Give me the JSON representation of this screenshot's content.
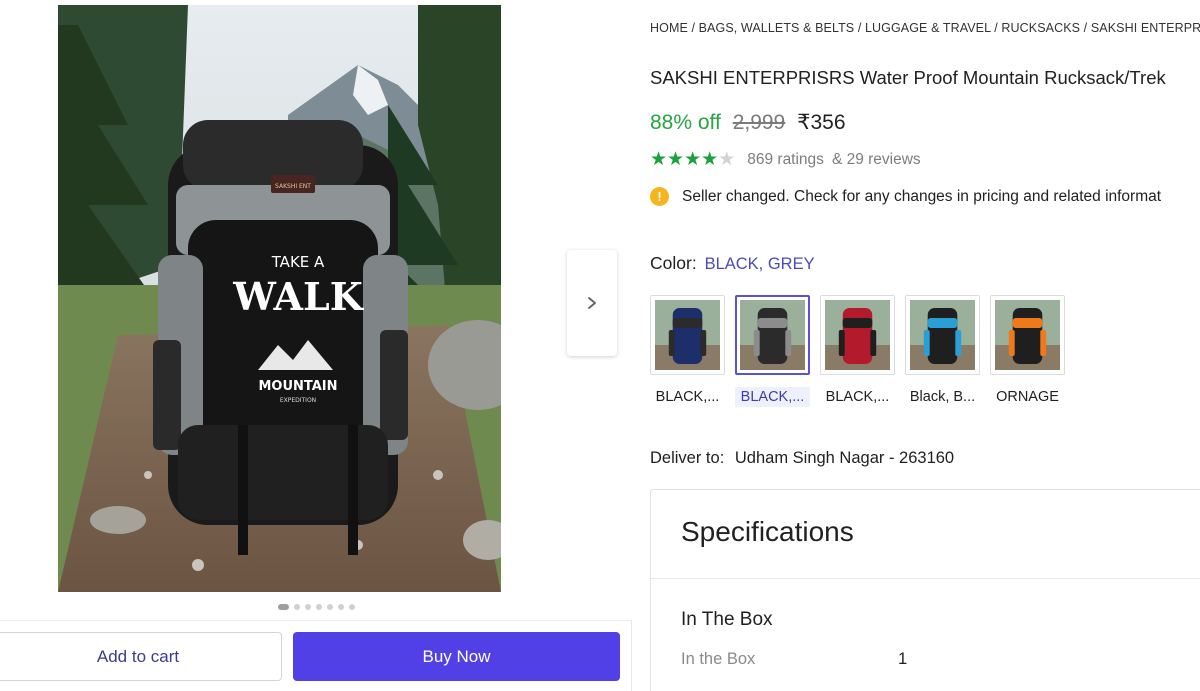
{
  "gallery": {
    "main_image_alt": "",
    "bag_brand_patch": "SAKSHI ENT",
    "bag_print_line1": "TAKE A",
    "bag_print_line2": "WALK",
    "bag_print_line3": "MOUNTAIN",
    "bag_print_line4": "EXPEDITION",
    "dots_count": 7,
    "active_dot": 0
  },
  "actions": {
    "add_to_cart": "Add to cart",
    "buy_now": "Buy Now"
  },
  "breadcrumb": [
    "HOME",
    "BAGS, WALLETS & BELTS",
    "LUGGAGE & TRAVEL",
    "RUCKSACKS",
    "SAKSHI ENTERPRISRS"
  ],
  "breadcrumb_separator": " / ",
  "product": {
    "title": "SAKSHI ENTERPRISRS Water Proof Mountain Rucksack/Trek",
    "discount": "88% off",
    "mrp": "2,999",
    "price": "₹356",
    "rating_stars": 4,
    "ratings_text": "869 ratings",
    "reviews_text": "& 29 reviews",
    "notice": "Seller changed. Check for any changes in pricing and related informat"
  },
  "color": {
    "label": "Color:",
    "value": "BLACK, GREY",
    "swatches": [
      {
        "label": "BLACK,...",
        "body": "#1c2f6b",
        "accent": "#2b2b2b",
        "selected": false
      },
      {
        "label": "BLACK,...",
        "body": "#2b2b2b",
        "accent": "#8c8c8c",
        "selected": true
      },
      {
        "label": "BLACK,...",
        "body": "#b31b2c",
        "accent": "#1f1f1f",
        "selected": false
      },
      {
        "label": "Black, B...",
        "body": "#1f1f1f",
        "accent": "#2a9fd6",
        "selected": false
      },
      {
        "label": "ORNAGE",
        "body": "#1f1f1f",
        "accent": "#f07a1a",
        "selected": false
      }
    ]
  },
  "delivery": {
    "label": "Deliver to:",
    "value": "Udham Singh Nagar - 263160"
  },
  "specifications": {
    "title": "Specifications",
    "section": "In The Box",
    "rows": [
      {
        "key": "In the Box",
        "value": "1"
      }
    ]
  }
}
